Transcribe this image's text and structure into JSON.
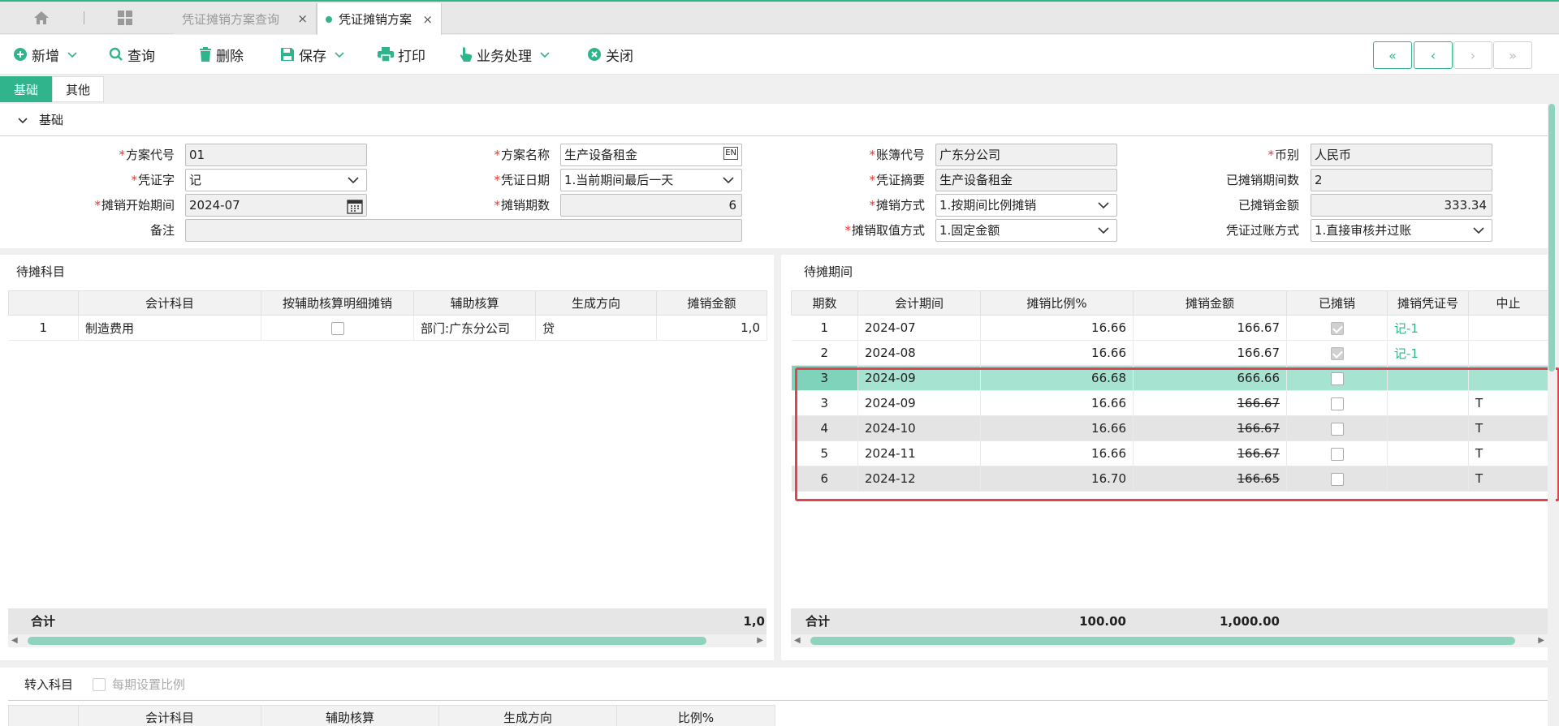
{
  "tabs": {
    "home_label": "",
    "inactive": {
      "label": "凭证摊销方案查询",
      "close": "×"
    },
    "active": {
      "label": "凭证摊销方案",
      "close": "×"
    }
  },
  "toolbar": {
    "add": "新增",
    "query": "查询",
    "delete": "删除",
    "save": "保存",
    "print": "打印",
    "business": "业务处理",
    "close": "关闭",
    "nav": [
      "«",
      "‹",
      "›",
      "»"
    ]
  },
  "subtabs": [
    "基础",
    "其他"
  ],
  "basic": {
    "section_title": "基础",
    "fields": {
      "plan_code": {
        "label": "方案代号",
        "value": "01"
      },
      "plan_name": {
        "label": "方案名称",
        "value": "生产设备租金"
      },
      "book_code": {
        "label": "账簿代号",
        "value": "广东分公司"
      },
      "currency": {
        "label": "币别",
        "value": "人民币"
      },
      "voucher_word": {
        "label": "凭证字",
        "value": "记"
      },
      "voucher_date": {
        "label": "凭证日期",
        "value": "1.当前期间最后一天"
      },
      "voucher_summary": {
        "label": "凭证摘要",
        "value": "生产设备租金"
      },
      "amortized_periods": {
        "label": "已摊销期间数",
        "value": "2"
      },
      "start_period": {
        "label": "摊销开始期间",
        "value": "2024-07"
      },
      "period_count": {
        "label": "摊销期数",
        "value": "6"
      },
      "method": {
        "label": "摊销方式",
        "value": "1.按期间比例摊销"
      },
      "amortized_amount": {
        "label": "已摊销金额",
        "value": "333.34"
      },
      "remark": {
        "label": "备注",
        "value": ""
      },
      "value_method": {
        "label": "摊销取值方式",
        "value": "1.固定金额"
      },
      "posting_method": {
        "label": "凭证过账方式",
        "value": "1.直接审核并过账"
      }
    }
  },
  "pending_accounts": {
    "title": "待摊科目",
    "headers": [
      "",
      "会计科目",
      "按辅助核算明细摊销",
      "辅助核算",
      "生成方向",
      "摊销金额"
    ],
    "rows": [
      {
        "no": "1",
        "account": "制造费用",
        "aux": "部门:广东分公司",
        "dir": "贷",
        "amount": "1,0"
      }
    ],
    "total_label": "合计",
    "total_amount": "1,0"
  },
  "pending_periods": {
    "title": "待摊期间",
    "headers": [
      "期数",
      "会计期间",
      "摊销比例%",
      "摊销金额",
      "已摊销",
      "摊销凭证号",
      "中止"
    ],
    "rows": [
      {
        "no": "1",
        "period": "2024-07",
        "ratio": "16.66",
        "amount": "166.67",
        "done": true,
        "voucher": "记-1",
        "stop": "",
        "strike": false,
        "style": ""
      },
      {
        "no": "2",
        "period": "2024-08",
        "ratio": "16.66",
        "amount": "166.67",
        "done": true,
        "voucher": "记-1",
        "stop": "",
        "strike": false,
        "style": ""
      },
      {
        "no": "3",
        "period": "2024-09",
        "ratio": "66.68",
        "amount": "666.66",
        "done": false,
        "voucher": "",
        "stop": "",
        "strike": false,
        "style": "sel"
      },
      {
        "no": "3",
        "period": "2024-09",
        "ratio": "16.66",
        "amount": "166.67",
        "done": false,
        "voucher": "",
        "stop": "T",
        "strike": true,
        "style": ""
      },
      {
        "no": "4",
        "period": "2024-10",
        "ratio": "16.66",
        "amount": "166.67",
        "done": false,
        "voucher": "",
        "stop": "T",
        "strike": true,
        "style": "alt"
      },
      {
        "no": "5",
        "period": "2024-11",
        "ratio": "16.66",
        "amount": "166.67",
        "done": false,
        "voucher": "",
        "stop": "T",
        "strike": true,
        "style": ""
      },
      {
        "no": "6",
        "period": "2024-12",
        "ratio": "16.70",
        "amount": "166.65",
        "done": false,
        "voucher": "",
        "stop": "T",
        "strike": true,
        "style": "alt"
      }
    ],
    "total_label": "合计",
    "total_ratio": "100.00",
    "total_amount": "1,000.00"
  },
  "transfer_accounts": {
    "title": "转入科目",
    "checkbox_label": "每期设置比例",
    "headers": [
      "",
      "会计科目",
      "辅助核算",
      "生成方向",
      "比例%"
    ]
  },
  "colors": {
    "accent": "#2fb48c",
    "highlight_box": "#e0454f",
    "selected_row": "#a6e3d1"
  }
}
